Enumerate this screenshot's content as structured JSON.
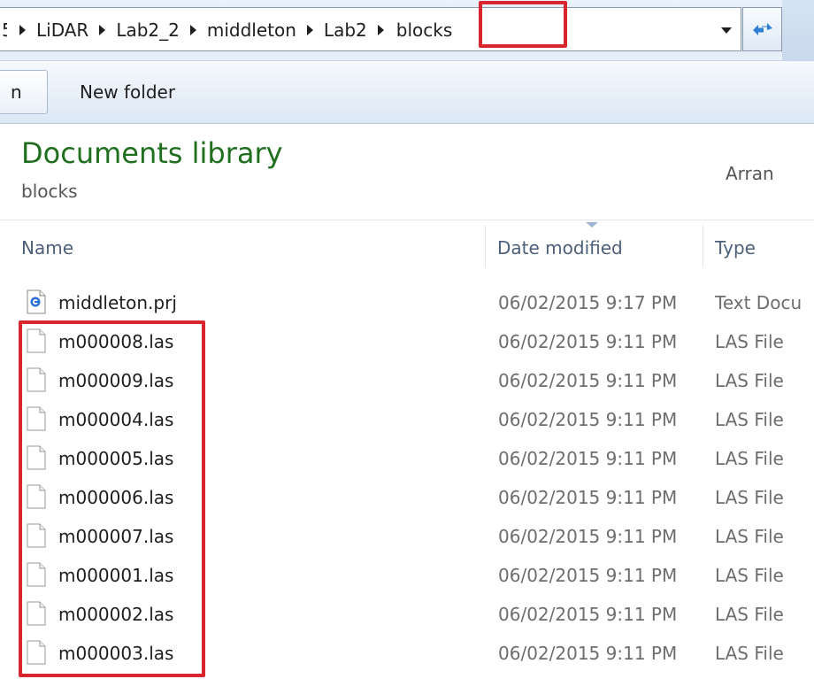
{
  "address_bar": {
    "crumbs": [
      {
        "label": "5"
      },
      {
        "label": "LiDAR"
      },
      {
        "label": "Lab2_2"
      },
      {
        "label": "middleton"
      },
      {
        "label": "Lab2"
      }
    ],
    "current_folder": "blocks"
  },
  "toolbar": {
    "cut_button_label": "n",
    "new_folder_label": "New folder"
  },
  "library": {
    "title": "Documents library",
    "subtitle": "blocks",
    "arrange_label": "Arran"
  },
  "columns": {
    "name": "Name",
    "date_modified": "Date modified",
    "type": "Type"
  },
  "files": [
    {
      "name": "middleton.prj",
      "date": "06/02/2015 9:17 PM",
      "type": "Text Docu",
      "icon": "text-document-icon"
    },
    {
      "name": "m000008.las",
      "date": "06/02/2015 9:11 PM",
      "type": "LAS File",
      "icon": "blank-file-icon"
    },
    {
      "name": "m000009.las",
      "date": "06/02/2015 9:11 PM",
      "type": "LAS File",
      "icon": "blank-file-icon"
    },
    {
      "name": "m000004.las",
      "date": "06/02/2015 9:11 PM",
      "type": "LAS File",
      "icon": "blank-file-icon"
    },
    {
      "name": "m000005.las",
      "date": "06/02/2015 9:11 PM",
      "type": "LAS File",
      "icon": "blank-file-icon"
    },
    {
      "name": "m000006.las",
      "date": "06/02/2015 9:11 PM",
      "type": "LAS File",
      "icon": "blank-file-icon"
    },
    {
      "name": "m000007.las",
      "date": "06/02/2015 9:11 PM",
      "type": "LAS File",
      "icon": "blank-file-icon"
    },
    {
      "name": "m000001.las",
      "date": "06/02/2015 9:11 PM",
      "type": "LAS File",
      "icon": "blank-file-icon"
    },
    {
      "name": "m000002.las",
      "date": "06/02/2015 9:11 PM",
      "type": "LAS File",
      "icon": "blank-file-icon"
    },
    {
      "name": "m000003.las",
      "date": "06/02/2015 9:11 PM",
      "type": "LAS File",
      "icon": "blank-file-icon"
    }
  ],
  "colors": {
    "highlight": "#d9252e",
    "library_title": "#1f6f1f",
    "column_header": "#4c607a"
  }
}
